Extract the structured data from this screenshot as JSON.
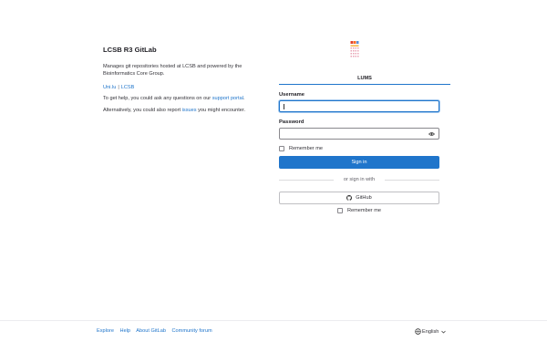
{
  "info": {
    "title": "LCSB R3 GitLab",
    "description": "Manages git repositories hosted at LCSB and powered by the Bioinformatics Core Group.",
    "link_unilu": "Uni.lu",
    "link_separator": "|",
    "link_lcsb": "LCSB",
    "help_prefix": "To get help, you could ask any questions on our ",
    "help_link": "support portal",
    "help_suffix": ".",
    "issues_prefix": "Alternatively, you could also report ",
    "issues_link": "issues",
    "issues_suffix": " you might encounter."
  },
  "login": {
    "tab_label": "LUMS",
    "username_label": "Username",
    "username_value": "",
    "password_label": "Password",
    "password_value": "",
    "remember_label": "Remember me",
    "sign_in_button": "Sign in",
    "divider_text": "or sign in with",
    "github_button": "GitHub",
    "remember_label_2": "Remember me"
  },
  "footer": {
    "links": [
      "Explore",
      "Help",
      "About GitLab",
      "Community forum"
    ],
    "language": "English"
  },
  "colors": {
    "accent": "#1f75cb",
    "text": "#333238",
    "border": "#89888d"
  },
  "icons": [
    "gitlab-logo-icon",
    "eye-icon",
    "github-icon",
    "globe-icon",
    "chevron-down-icon"
  ]
}
